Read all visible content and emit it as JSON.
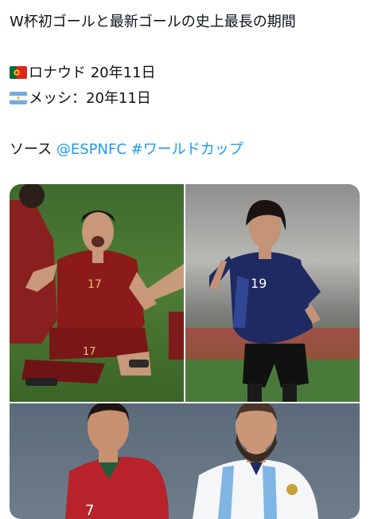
{
  "tweet": {
    "title": "W杯初ゴールと最新ゴールの史上最長の期間",
    "ronaldo_line": "ロナウド 20年11日",
    "messi_line": "メッシ：20年11日",
    "source_label": "ソース",
    "mention": "@ESPNFC",
    "hashtag": "#ワールドカップ"
  },
  "media": {
    "photos": [
      {
        "name": "ronaldo-celebration-photo",
        "jersey_number": "17"
      },
      {
        "name": "messi-celebration-photo",
        "jersey_number": "19"
      },
      {
        "name": "ronaldo-messi-portrait-photo"
      }
    ]
  },
  "icons": [
    "portugal-flag-icon",
    "argentina-flag-icon"
  ],
  "colors": {
    "link": "#1d9bf0",
    "text": "#0f1419"
  }
}
